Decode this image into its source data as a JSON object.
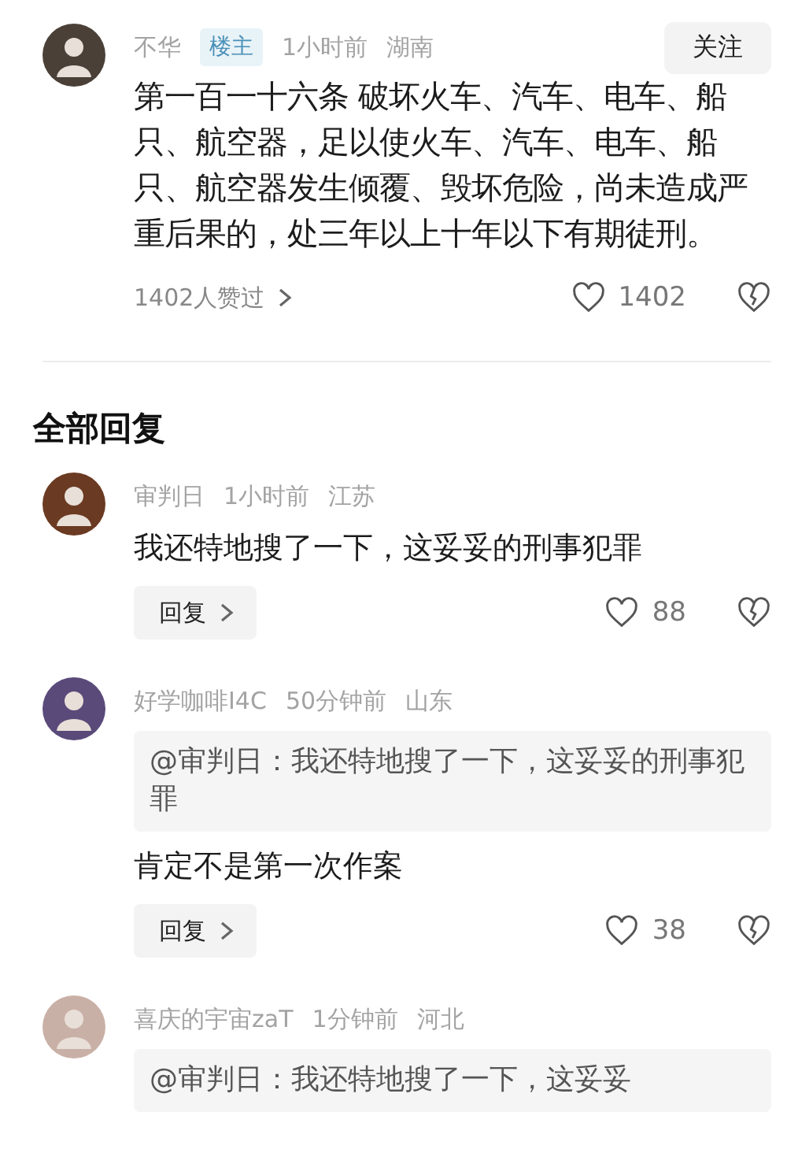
{
  "post": {
    "author": "不华",
    "badge": "楼主",
    "time": "1小时前",
    "location": "湖南",
    "follow_button": "关注",
    "text": "第一百一十六条 破坏火车、汽车、电车、船只、航空器，足以使火车、汽车、电车、船只、航空器发生倾覆、毁坏危险，尚未造成严重后果的，处三年以上十年以下有期徒刑。",
    "liked_by": "1402人赞过",
    "likes": "1402"
  },
  "section_title": "全部回复",
  "replies": [
    {
      "author": "审判日",
      "time": "1小时前",
      "location": "江苏",
      "text": "我还特地搜了一下，这妥妥的刑事犯罪",
      "reply_button": "回复",
      "likes": "88"
    },
    {
      "author": "好学咖啡I4C",
      "time": "50分钟前",
      "location": "山东",
      "quote": "@审判日：我还特地搜了一下，这妥妥的刑事犯罪",
      "text": "肯定不是第一次作案",
      "reply_button": "回复",
      "likes": "38"
    },
    {
      "author": "喜庆的宇宙zaT",
      "time": "1分钟前",
      "location": "河北",
      "quote": "@审判日：我还特地搜了一下，这妥妥"
    }
  ]
}
